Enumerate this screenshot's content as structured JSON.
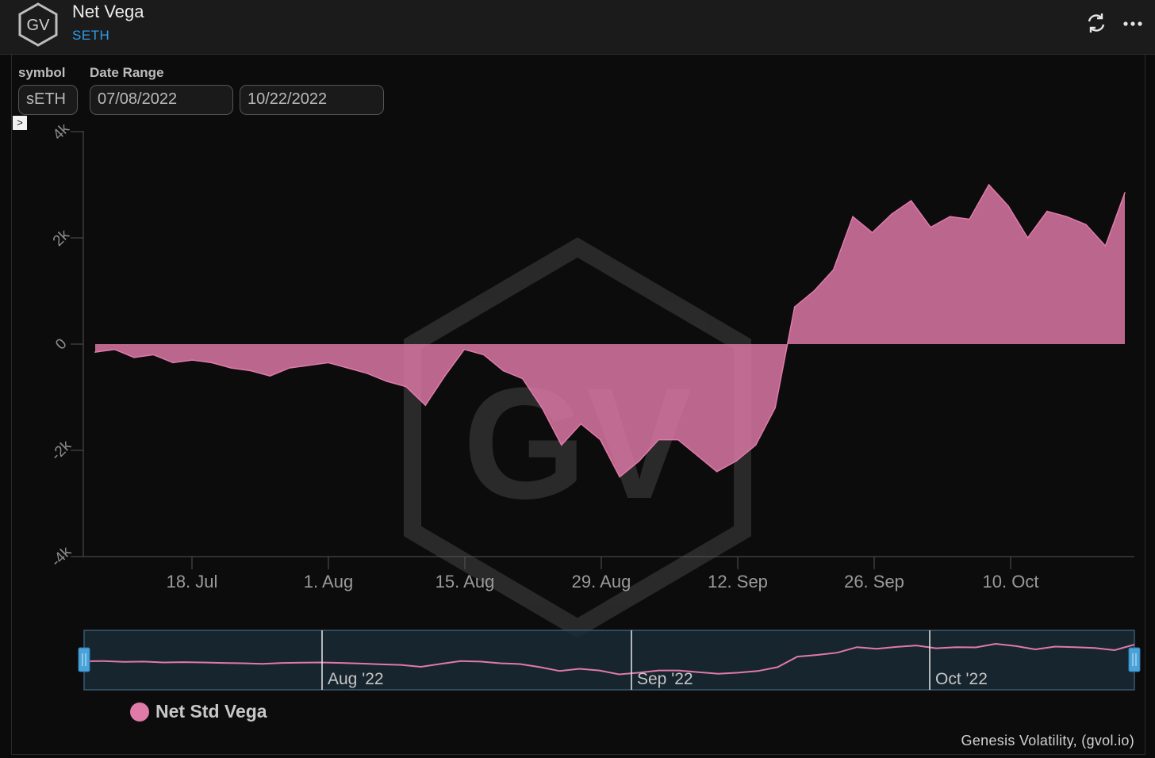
{
  "header": {
    "logo_text": "GV",
    "title": "Net Vega",
    "subtitle": "SETH",
    "refresh_icon": "refresh-icon",
    "menu_icon": "more-horizontal-icon"
  },
  "filters": {
    "symbol_label": "symbol",
    "symbol_value": "sETH",
    "date_range_label": "Date Range",
    "date_start": "07/08/2022",
    "date_end": "10/22/2022"
  },
  "expander_glyph": ">",
  "chart_data": {
    "type": "area",
    "title": "",
    "xlabel": "",
    "ylabel": "",
    "ylim": [
      -4000,
      4000
    ],
    "yticks": [
      "4k",
      "2k",
      "0",
      "-2k",
      "-4k"
    ],
    "xticks": [
      "18. Jul",
      "1. Aug",
      "15. Aug",
      "29. Aug",
      "12. Sep",
      "26. Sep",
      "10. Oct"
    ],
    "xrange": [
      "2022-07-08",
      "2022-10-22"
    ],
    "series": [
      {
        "name": "Net Std Vega",
        "color": "#e07aa9",
        "x": [
          "2022-07-08",
          "2022-07-10",
          "2022-07-12",
          "2022-07-14",
          "2022-07-16",
          "2022-07-18",
          "2022-07-20",
          "2022-07-22",
          "2022-07-24",
          "2022-07-26",
          "2022-07-28",
          "2022-07-30",
          "2022-08-01",
          "2022-08-03",
          "2022-08-05",
          "2022-08-07",
          "2022-08-09",
          "2022-08-11",
          "2022-08-13",
          "2022-08-15",
          "2022-08-17",
          "2022-08-19",
          "2022-08-21",
          "2022-08-23",
          "2022-08-25",
          "2022-08-27",
          "2022-08-29",
          "2022-08-31",
          "2022-09-02",
          "2022-09-04",
          "2022-09-06",
          "2022-09-08",
          "2022-09-10",
          "2022-09-12",
          "2022-09-14",
          "2022-09-16",
          "2022-09-18",
          "2022-09-20",
          "2022-09-22",
          "2022-09-24",
          "2022-09-26",
          "2022-09-28",
          "2022-09-30",
          "2022-10-02",
          "2022-10-04",
          "2022-10-06",
          "2022-10-08",
          "2022-10-10",
          "2022-10-12",
          "2022-10-14",
          "2022-10-16",
          "2022-10-18",
          "2022-10-20",
          "2022-10-22"
        ],
        "values": [
          -150,
          -100,
          -250,
          -200,
          -350,
          -300,
          -350,
          -450,
          -500,
          -600,
          -450,
          -400,
          -350,
          -450,
          -550,
          -700,
          -800,
          -1150,
          -600,
          -100,
          -200,
          -500,
          -650,
          -1200,
          -1900,
          -1500,
          -1800,
          -2500,
          -2200,
          -1800,
          -1800,
          -2100,
          -2400,
          -2200,
          -1900,
          -1200,
          700,
          1000,
          1400,
          2400,
          2100,
          2450,
          2700,
          2200,
          2400,
          2350,
          3000,
          2600,
          2000,
          2500,
          2400,
          2250,
          1850,
          2850
        ]
      }
    ],
    "navigator": {
      "labels": [
        "Aug '22",
        "Sep '22",
        "Oct '22"
      ]
    },
    "legend": "bottom-left",
    "grid": false,
    "watermark": "GV"
  },
  "legend": {
    "label": "Net Std Vega"
  },
  "credit": "Genesis Volatility, (gvol.io)"
}
